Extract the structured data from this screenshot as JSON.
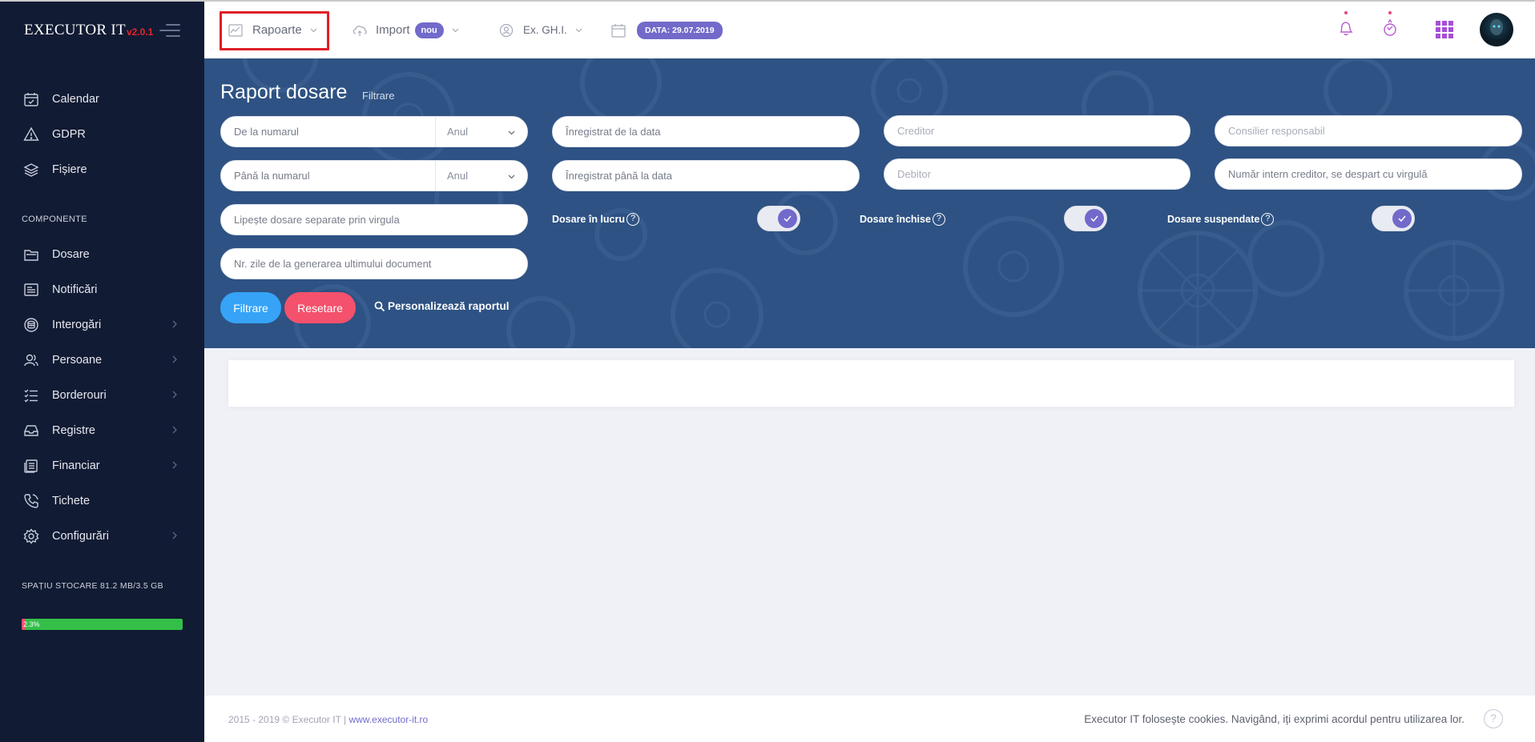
{
  "app": {
    "brand": "EXECUTOR IT",
    "version": "v2.0.1"
  },
  "sidebar": {
    "items_top": [
      {
        "label": "Calendar",
        "icon": "calendar-icon"
      },
      {
        "label": "GDPR",
        "icon": "warning-icon"
      },
      {
        "label": "Fișiere",
        "icon": "layers-icon"
      }
    ],
    "section_title": "COMPONENTE",
    "items_components": [
      {
        "label": "Dosare",
        "icon": "folder-icon",
        "has_submenu": false
      },
      {
        "label": "Notificări",
        "icon": "notification-icon",
        "has_submenu": false
      },
      {
        "label": "Interogări",
        "icon": "database-icon",
        "has_submenu": true
      },
      {
        "label": "Persoane",
        "icon": "users-icon",
        "has_submenu": true
      },
      {
        "label": "Borderouri",
        "icon": "checklist-icon",
        "has_submenu": true
      },
      {
        "label": "Registre",
        "icon": "inbox-icon",
        "has_submenu": true
      },
      {
        "label": "Financiar",
        "icon": "coins-icon",
        "has_submenu": true
      },
      {
        "label": "Tichete",
        "icon": "phone-icon",
        "has_submenu": false
      },
      {
        "label": "Configurări",
        "icon": "gear-icon",
        "has_submenu": true
      }
    ],
    "storage": {
      "title": "SPAȚIU STOCARE 81.2 MB/3.5 GB",
      "percent_label": "2.3%",
      "percent": 2.3,
      "fill_color": "#34bf49"
    }
  },
  "header": {
    "nav": {
      "rapoarte": "Rapoarte",
      "import": "Import",
      "import_badge": "nou",
      "ex_ghi": "Ex. GH.I.",
      "date_badge": "DATA: 29.07.2019"
    },
    "accent_color": "#716aca"
  },
  "report": {
    "title": "Raport dosare",
    "subtitle": "Filtrare",
    "filters": {
      "from_number_placeholder": "De la numarul",
      "to_number_placeholder": "Până la numarul",
      "year_select_1": "Anul",
      "year_select_2": "Anul",
      "registered_from_placeholder": "Înregistrat de la data",
      "registered_to_placeholder": "Înregistrat până la data",
      "creditor_placeholder": "Creditor",
      "debitor_placeholder": "Debitor",
      "consilier_placeholder": "Consilier responsabil",
      "internal_number_placeholder": "Număr intern creditor, se despart cu virgulă",
      "paste_files_placeholder": "Lipește dosare separate prin virgula",
      "days_placeholder": "Nr. zile de la generarea ultimului document"
    },
    "toggles": [
      {
        "label": "Dosare în lucru",
        "checked": true
      },
      {
        "label": "Dosare închise",
        "checked": true
      },
      {
        "label": "Dosare suspendate",
        "checked": true
      }
    ],
    "buttons": {
      "filter": "Filtrare",
      "reset": "Resetare",
      "customize": "Personalizează raportul"
    }
  },
  "footer": {
    "copyright": "2015 - 2019 © Executor IT | ",
    "link": "www.executor-it.ro",
    "cookie": "Executor IT folosește cookies. Navigând, iți exprimi acordul pentru utilizarea lor.",
    "help": "?"
  }
}
